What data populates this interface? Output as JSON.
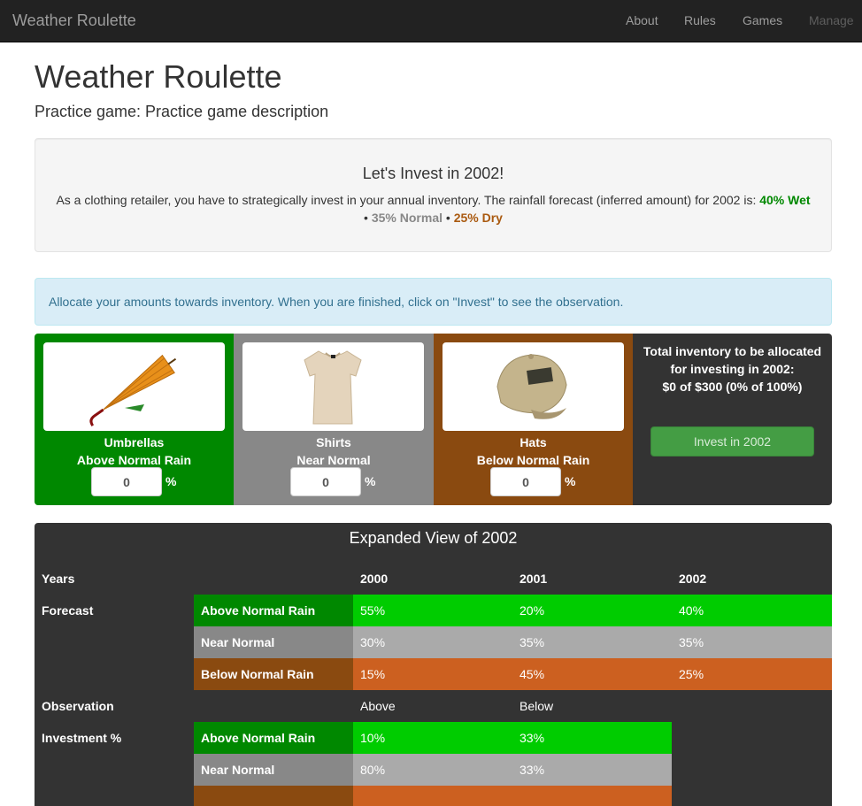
{
  "nav": {
    "brand": "Weather Roulette",
    "links": [
      "About",
      "Rules",
      "Games",
      "Manage"
    ]
  },
  "page": {
    "title": "Weather Roulette",
    "subtitle": "Practice game: Practice game description"
  },
  "well": {
    "heading": "Let's Invest in 2002!",
    "text": "As a clothing retailer, you have to strategically invest in your annual inventory. The rainfall forecast (inferred amount) for 2002 is:",
    "wet": "40% Wet",
    "sep": "•",
    "normal": "35% Normal",
    "dry": "25% Dry"
  },
  "alert": {
    "text": "Allocate your amounts towards inventory. When you are finished, click on \"Invest\" to see the observation."
  },
  "investment": {
    "items": [
      {
        "name": "Umbrellas",
        "condition": "Above Normal Rain",
        "value": "0",
        "icon": "umbrella-image"
      },
      {
        "name": "Shirts",
        "condition": "Near Normal",
        "value": "0",
        "icon": "shirt-image"
      },
      {
        "name": "Hats",
        "condition": "Below Normal Rain",
        "value": "0",
        "icon": "hat-image"
      }
    ],
    "percent_sign": "%",
    "total_line1": "Total inventory to be allocated",
    "total_line2": "for investing in 2002:",
    "total_line3": "$0 of $300 (0% of 100%)",
    "button": "Invest in 2002"
  },
  "expanded": {
    "title": "Expanded View of 2002",
    "years_label": "Years",
    "years": [
      "2000",
      "2001",
      "2002"
    ],
    "forecast_label": "Forecast",
    "categories": [
      "Above Normal Rain",
      "Near Normal",
      "Below Normal Rain"
    ],
    "forecast": [
      [
        "55%",
        "20%",
        "40%"
      ],
      [
        "30%",
        "35%",
        "35%"
      ],
      [
        "15%",
        "45%",
        "25%"
      ]
    ],
    "observation_label": "Observation",
    "observations": [
      "Above",
      "Below"
    ],
    "investment_label": "Investment %",
    "investment": [
      [
        "10%",
        "33%"
      ],
      [
        "80%",
        "33%"
      ]
    ]
  },
  "colors": {
    "navbar": "#222222",
    "wet": "#008800",
    "normal": "#888888",
    "dry": "#8a4a10",
    "bright_green": "#00cc00",
    "silver": "#aaaaaa",
    "orange": "#cc6020",
    "invest_button": "#449d44"
  }
}
